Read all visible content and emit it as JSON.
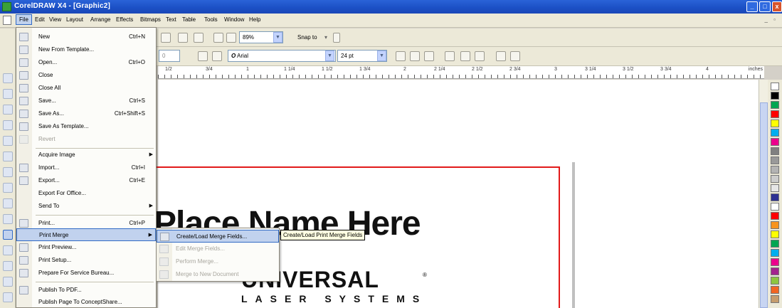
{
  "window": {
    "title": "CorelDRAW X4 - [Graphic2]"
  },
  "menubar": {
    "items": [
      "File",
      "Edit",
      "View",
      "Layout",
      "Arrange",
      "Effects",
      "Bitmaps",
      "Text",
      "Table",
      "Tools",
      "Window",
      "Help"
    ]
  },
  "toolbar": {
    "zoom": "89%",
    "snap_to": "Snap to"
  },
  "property_bar": {
    "font": "Arial",
    "font_size": "24 pt"
  },
  "ruler": {
    "ticks": [
      "1/2",
      "3/4",
      "1",
      "1 1/4",
      "1 1/2",
      "1 3/4",
      "2",
      "2 1/4",
      "2 1/2",
      "2 3/4",
      "3",
      "3 1/4",
      "3 1/2",
      "3 3/4",
      "4"
    ],
    "unit": "inches"
  },
  "file_menu": {
    "items": [
      {
        "label": "New",
        "shortcut": "Ctrl+N"
      },
      {
        "label": "New From Template...",
        "shortcut": ""
      },
      {
        "label": "Open...",
        "shortcut": "Ctrl+O"
      },
      {
        "label": "Close",
        "shortcut": ""
      },
      {
        "label": "Close All",
        "shortcut": ""
      },
      {
        "label": "Save...",
        "shortcut": "Ctrl+S"
      },
      {
        "label": "Save As...",
        "shortcut": "Ctrl+Shift+S"
      },
      {
        "label": "Save As Template...",
        "shortcut": ""
      },
      {
        "label": "Revert",
        "shortcut": ""
      },
      {
        "label": "Acquire Image",
        "shortcut": ""
      },
      {
        "label": "Import...",
        "shortcut": "Ctrl+I"
      },
      {
        "label": "Export...",
        "shortcut": "Ctrl+E"
      },
      {
        "label": "Export For Office...",
        "shortcut": ""
      },
      {
        "label": "Send To",
        "shortcut": ""
      },
      {
        "label": "Print...",
        "shortcut": "Ctrl+P"
      },
      {
        "label": "Print Merge",
        "shortcut": ""
      },
      {
        "label": "Print Preview...",
        "shortcut": ""
      },
      {
        "label": "Print Setup...",
        "shortcut": ""
      },
      {
        "label": "Prepare For Service Bureau...",
        "shortcut": ""
      },
      {
        "label": "Publish To PDF...",
        "shortcut": ""
      },
      {
        "label": "Publish Page To ConceptShare...",
        "shortcut": ""
      }
    ]
  },
  "print_merge_submenu": {
    "items": [
      {
        "label": "Create/Load Merge Fields..."
      },
      {
        "label": "Edit Merge Fields..."
      },
      {
        "label": "Perform Merge..."
      },
      {
        "label": "Merge to New Document"
      }
    ]
  },
  "tooltip": "Create/Load Print Merge Fields",
  "document": {
    "heading": "Place Name Here",
    "logo_main": "UNIVERSAL",
    "logo_sub": "LASER SYSTEMS",
    "logo_reg": "®"
  },
  "colors": {
    "titlebar": "#2a63d8",
    "menu_highlight": "#c1d2ee",
    "page_border": "#e21a1a",
    "palette": [
      "#ffffff",
      "#000000",
      "#00a651",
      "#ff0000",
      "#ffff00",
      "#00aeef",
      "#ec008c",
      "#808080",
      "#999999",
      "#b3b3b3",
      "#cccccc",
      "#e6e6e6",
      "#2e3192",
      "#ffffff",
      "#ff0000",
      "#f7941d",
      "#ffff00",
      "#00a651",
      "#00aeef",
      "#ec008c",
      "#a3238e",
      "#8dc63f",
      "#f26522",
      "#c69c6d"
    ]
  }
}
